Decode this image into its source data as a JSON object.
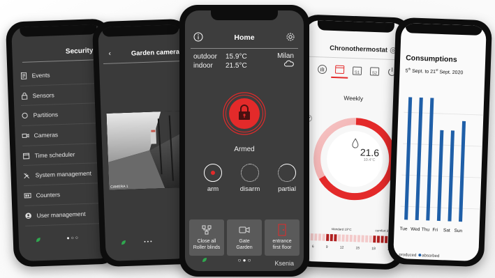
{
  "security": {
    "title": "Security",
    "items": [
      {
        "label": "Events",
        "icon": "document-icon"
      },
      {
        "label": "Sensors",
        "icon": "lock-icon"
      },
      {
        "label": "Partitions",
        "icon": "circle-icon"
      },
      {
        "label": "Cameras",
        "icon": "camera-icon"
      },
      {
        "label": "Time scheduler",
        "icon": "calendar-icon"
      },
      {
        "label": "System management",
        "icon": "tools-icon"
      },
      {
        "label": "Counters",
        "icon": "counter-icon"
      },
      {
        "label": "User management",
        "icon": "user-icon"
      }
    ],
    "page_indicator": "● ○ ○"
  },
  "camera": {
    "title": "Garden camera",
    "back": "‹",
    "cam_label": "CAMERA 1"
  },
  "home": {
    "title": "Home",
    "outdoor_label": "outdoor",
    "outdoor_value": "15.9°C",
    "indoor_label": "indoor",
    "indoor_value": "21.5°C",
    "city": "Milan",
    "status": "Armed",
    "modes": [
      {
        "label": "arm"
      },
      {
        "label": "disarm"
      },
      {
        "label": "partial"
      }
    ],
    "tiles": [
      {
        "line1": "Close all",
        "line2": "Roller blinds"
      },
      {
        "line1": "Gate",
        "line2": "Garden"
      },
      {
        "line1": "entrance",
        "line2": "first floor"
      }
    ],
    "page_indicator": "○ ● ○",
    "brand": "Ksenia",
    "accent": "#e32a2a"
  },
  "thermo": {
    "title": "Chronothermostat",
    "schedule_label": "Weekly",
    "temperature": "21.6",
    "sub_temperature": "10.4°C",
    "mode_labels": [
      "S1",
      "S2"
    ],
    "legend": [
      "°C",
      "standard 19°C",
      "comfort 21.5°C"
    ],
    "hours": [
      "6",
      "9",
      "12",
      "15",
      "18",
      "21"
    ]
  },
  "consumption": {
    "title": "Consumptions",
    "range_start_day": "5",
    "range_start_suffix": "th",
    "range_mid": " Sept. to 21",
    "range_end_suffix": "st",
    "range_end": " Sept. 2020",
    "legend_produced": "produced",
    "legend_absorbed": "absorbed",
    "bar_color": "#1f5fa8"
  },
  "chart_data": {
    "type": "bar",
    "categories": [
      "Tue",
      "Wed",
      "Thu",
      "Fri",
      "Sat",
      "Sun"
    ],
    "series": [
      {
        "name": "absorbed",
        "values": [
          1.0,
          1.0,
          1.0,
          0.74,
          0.74,
          0.82
        ]
      }
    ]
  }
}
